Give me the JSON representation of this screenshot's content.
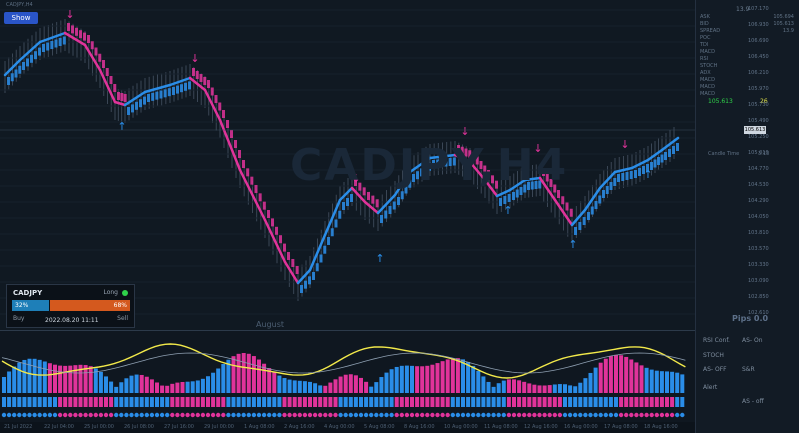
{
  "window": {
    "title": "CADJPY,H4"
  },
  "toolbar": {
    "show_label": "Show"
  },
  "watermark": {
    "symbol": "CADJPY,H4"
  },
  "chart": {
    "month_label": "August",
    "current_price": "105.613"
  },
  "info_box": {
    "pair": "CADJPY",
    "direction": "Long",
    "buy_pct": "32%",
    "sell_pct": "68%",
    "buy_label": "Buy",
    "sell_label": "Sell",
    "datetime": "2022.08.20 11:11",
    "buy_fraction": 0.32,
    "direction_color": "#2fd24a"
  },
  "right_panel": {
    "spread": "13.9",
    "rows": [
      {
        "label": "ASK",
        "value": "105.694"
      },
      {
        "label": "BID",
        "value": "105.613"
      },
      {
        "label": "SPREAD",
        "value": "13.9"
      },
      {
        "label": "POC",
        "value": ""
      },
      {
        "label": "TDI",
        "value": ""
      },
      {
        "label": "MACD",
        "value": ""
      },
      {
        "label": "RSI",
        "value": ""
      },
      {
        "label": "STOCH",
        "value": ""
      },
      {
        "label": "ADX",
        "value": ""
      },
      {
        "label": "MACD",
        "value": ""
      },
      {
        "label": "MACD",
        "value": ""
      },
      {
        "label": "MACD",
        "value": ""
      }
    ],
    "bid_highlight": "105.613",
    "bid_extra": "26",
    "candle_time_label": "Candle Time",
    "candle_time_value": "3:13",
    "pips": "Pips 0.0"
  },
  "price_ticks": [
    "107.170",
    "106.930",
    "106.690",
    "106.450",
    "106.210",
    "105.970",
    "105.730",
    "105.490",
    "105.250",
    "105.010",
    "104.770",
    "104.530",
    "104.290",
    "104.050",
    "103.810",
    "103.570",
    "103.330",
    "103.090",
    "102.850",
    "102.610"
  ],
  "indicator_panel": {
    "buttons": [
      {
        "label": "RSI Conf."
      },
      {
        "label": "AS- On"
      },
      {
        "label": "STOCH"
      },
      {
        "label": "AS- OFF"
      },
      {
        "label": "S&R"
      },
      {
        "label": "Alert"
      },
      {
        "label": "AS - off"
      }
    ]
  },
  "time_axis": [
    "21 Jul 2022",
    "22 Jul 04:00",
    "25 Jul 00:00",
    "26 Jul 08:00",
    "27 Jul 16:00",
    "29 Jul 00:00",
    "1 Aug 08:00",
    "2 Aug 16:00",
    "4 Aug 00:00",
    "5 Aug 08:00",
    "8 Aug 16:00",
    "10 Aug 00:00",
    "11 Aug 08:00",
    "12 Aug 16:00",
    "16 Aug 00:00",
    "17 Aug 08:00",
    "18 Aug 16:00"
  ],
  "colors": {
    "up": "#2a8de8",
    "down": "#e0339a",
    "signal": "#f2e94a",
    "bg": "#0f1720"
  }
}
